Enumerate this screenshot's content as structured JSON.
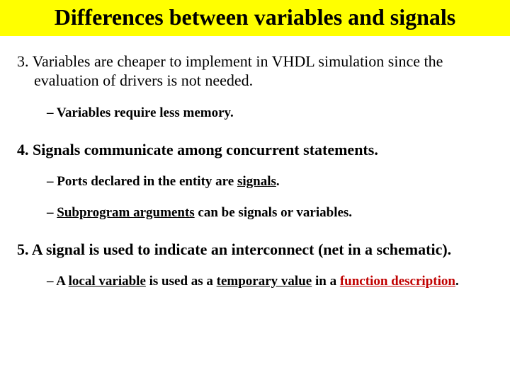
{
  "title": "Differences between variables and signals",
  "points": {
    "p3": {
      "num": "3.",
      "text": "Variables are cheaper to implement in VHDL simulation since the evaluation of drivers is not needed.",
      "subs": [
        "Variables require less memory."
      ]
    },
    "p4": {
      "num": "4.",
      "lead": "Signals communicate among concurrent statements.",
      "sub1_lead": "Ports declared in the entity are ",
      "sub1_u": "signals",
      "sub1_tail": ".",
      "sub2_u": "Subprogram arguments",
      "sub2_tail": " can be signals or variables."
    },
    "p5": {
      "num": "5.",
      "text": "A signal is used to indicate an interconnect (net in a schematic).",
      "sub_a": "A ",
      "sub_b": "local variable",
      "sub_c": " is used as a ",
      "sub_d": "temporary value",
      "sub_e": " in a ",
      "sub_f": "function description",
      "sub_g": "."
    }
  }
}
